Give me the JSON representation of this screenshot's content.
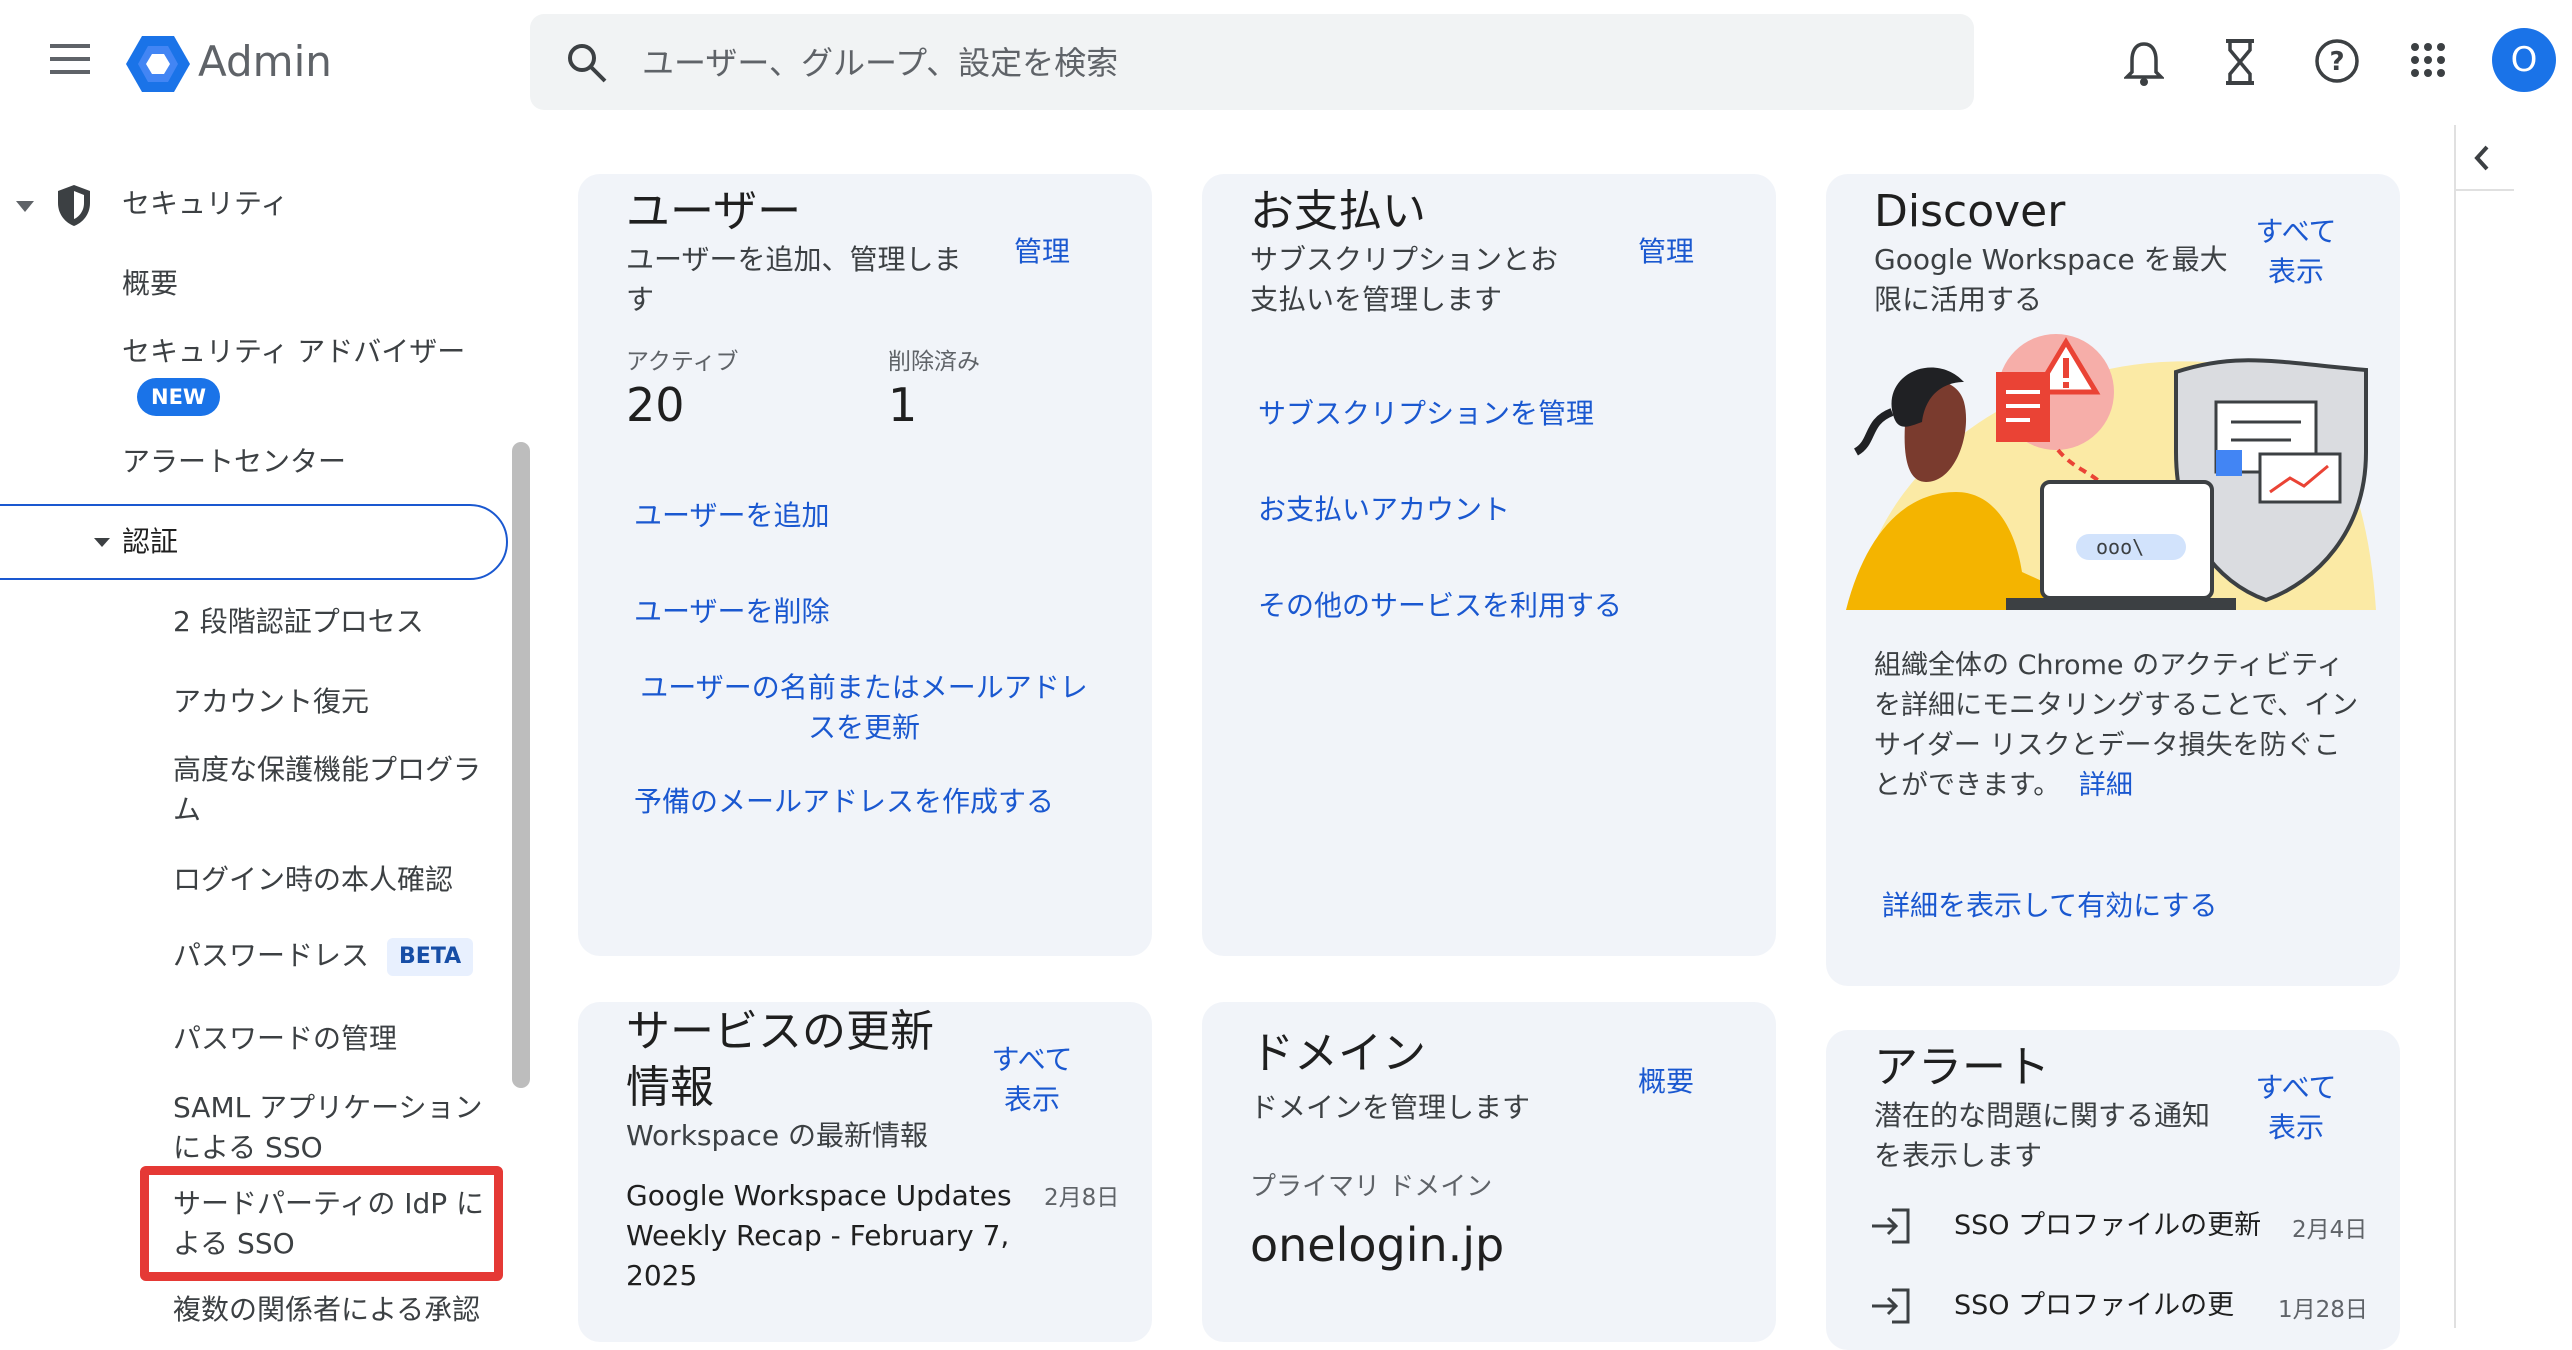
{
  "header": {
    "app_name": "Admin",
    "search_placeholder": "ユーザー、グループ、設定を検索",
    "avatar_initial": "O",
    "brand_color": "#1a73e8"
  },
  "sidebar": {
    "section_label": "セキュリティ",
    "items": [
      {
        "label": "概要"
      },
      {
        "label": "セキュリティ アドバイザー",
        "badge": "NEW"
      },
      {
        "label": "アラートセンター"
      }
    ],
    "auth_label": "認証",
    "auth_items": [
      {
        "label": "2 段階認証プロセス"
      },
      {
        "label": "アカウント復元"
      },
      {
        "label": "高度な保護機能プログラム"
      },
      {
        "label": "ログイン時の本人確認"
      },
      {
        "label": "パスワードレス",
        "badge": "BETA"
      },
      {
        "label": "パスワードの管理"
      },
      {
        "label": "SAML アプリケーションによる SSO"
      },
      {
        "label": "サードパーティの IdP による SSO"
      },
      {
        "label": "複数の関係者による承認"
      }
    ]
  },
  "cards": {
    "users": {
      "title": "ユーザー",
      "subtitle": "ユーザーを追加、管理します",
      "action": "管理",
      "active_label": "アクティブ",
      "active_count": "20",
      "deleted_label": "削除済み",
      "deleted_count": "1",
      "links": [
        "ユーザーを追加",
        "ユーザーを削除",
        "ユーザーの名前またはメールアドレスを更新",
        "予備のメールアドレスを作成する"
      ]
    },
    "billing": {
      "title": "お支払い",
      "subtitle": "サブスクリプションとお支払いを管理します",
      "action": "管理",
      "links": [
        "サブスクリプションを管理",
        "お支払いアカウント",
        "その他のサービスを利用する"
      ]
    },
    "discover": {
      "title": "Discover",
      "subtitle": "Google Workspace を最大限に活用する",
      "action": "すべて表示",
      "body": "組織全体の Chrome のアクティビティを詳細にモニタリングすることで、インサイダー リスクとデータ損失を防ぐことができます。",
      "detail_link": "詳細",
      "cta": "詳細を表示して有効にする"
    },
    "updates": {
      "title": "サービスの更新情報",
      "subtitle": "Workspace の最新情報",
      "action": "すべて表示",
      "item_title": "Google Workspace Updates Weekly Recap - February 7, 2025",
      "item_date": "2月8日"
    },
    "domain": {
      "title": "ドメイン",
      "subtitle": "ドメインを管理します",
      "action": "概要",
      "primary_label": "プライマリ ドメイン",
      "primary_value": "onelogin.jp"
    },
    "alerts": {
      "title": "アラート",
      "subtitle": "潜在的な問題に関する通知を表示します",
      "action": "すべて表示",
      "items": [
        {
          "text": "SSO プロファイルの更新",
          "date": "2月4日"
        },
        {
          "text": "SSO プロファイルの更",
          "date": "1月28日"
        }
      ]
    }
  }
}
